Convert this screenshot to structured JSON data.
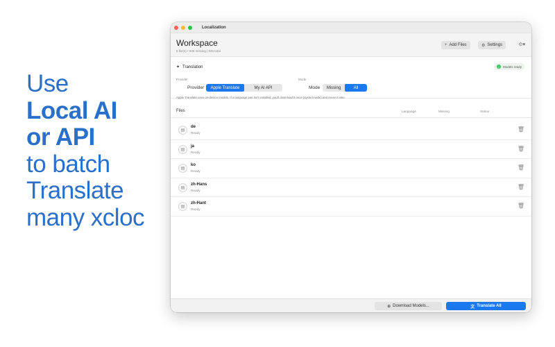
{
  "promo": {
    "lines": [
      "Use",
      "Local AI",
      "or API",
      "to batch",
      "Translate",
      "many xcloc"
    ]
  },
  "window": {
    "title": "Localization",
    "workspace_title": "Workspace",
    "workspace_subtitle": "5 file(s) • 845 missing | 845 total",
    "add_files_label": "Add Files",
    "settings_label": "Settings",
    "more_icon": "ellipsis-circle-icon"
  },
  "translation": {
    "title": "Translation",
    "models_badge": "Models ready",
    "provider_caption": "Provider",
    "provider_label": "Provider",
    "provider_options": [
      "Apple Translate",
      "My AI API"
    ],
    "provider_selected": "Apple Translate",
    "mode_caption": "Mode",
    "mode_label": "Mode",
    "mode_options": [
      "Missing",
      "All"
    ],
    "mode_selected": "All",
    "note": "Apple Translate uses on-device models. If a language pair isn't installed, you'll download it once (system-wide) and reuse it later."
  },
  "files": {
    "header": "Files",
    "columns": [
      "Language",
      "Missing",
      "Status"
    ],
    "rows": [
      {
        "name": "de",
        "status": "Ready"
      },
      {
        "name": "ja",
        "status": "Ready"
      },
      {
        "name": "ko",
        "status": "Ready"
      },
      {
        "name": "zh-Hans",
        "status": "Ready"
      },
      {
        "name": "zh-Hant",
        "status": "Ready"
      }
    ]
  },
  "footer": {
    "download_label": "Download Models...",
    "translate_label": "Translate All"
  },
  "colors": {
    "accent": "#1b79f0",
    "promo_text": "#2a6fc9",
    "ready_badge": "#34c759"
  }
}
